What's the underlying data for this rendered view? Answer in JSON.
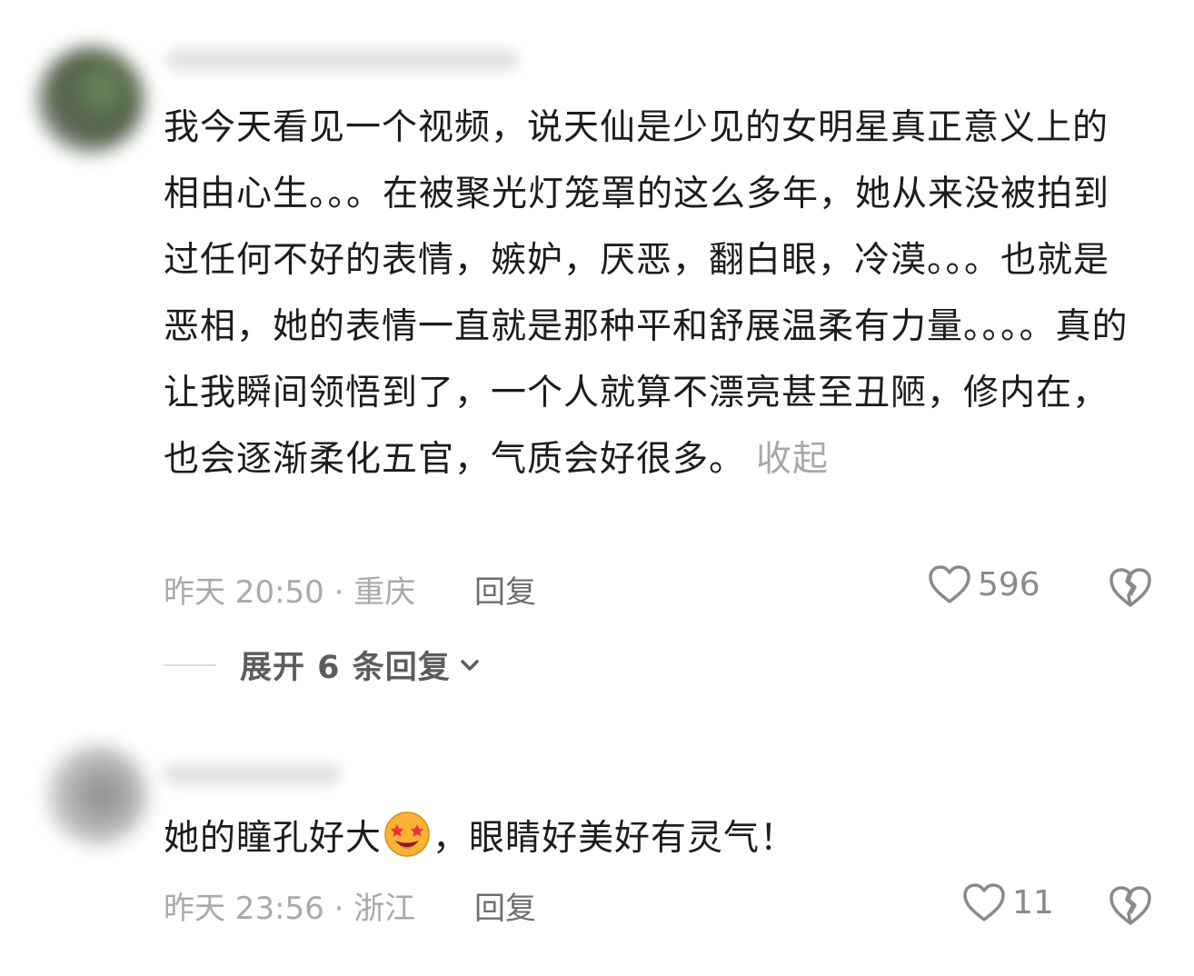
{
  "comments": [
    {
      "text": "我今天看见一个视频，说天仙是少见的女明星真正意义上的相由心生。。。在被聚光灯笼罩的这么多年，她从来没被拍到过任何不好的表情，嫉妒，厌恶，翻白眼，冷漠。。。也就是恶相，她的表情一直就是那种平和舒展温柔有力量。。。。真的让我瞬间领悟到了，一个人就算不漂亮甚至丑陋，修内在，也会逐渐柔化五官，气质会好很多。",
      "collapse_label": "收起",
      "meta": "昨天 20:50 · 重庆",
      "reply_label": "回复",
      "likes": "596",
      "expand_label": "展开 6 条回复"
    },
    {
      "text_before_emoji": "她的瞳孔好大",
      "emoji": "star-struck-face",
      "text_after_emoji": "，眼睛好美好有灵气！",
      "meta": "昨天 23:56 · 浙江",
      "reply_label": "回复",
      "likes": "11"
    }
  ],
  "colors": {
    "text": "#1c1c1c",
    "secondary": "#a9a9a9",
    "icon": "#8a8a8a"
  }
}
